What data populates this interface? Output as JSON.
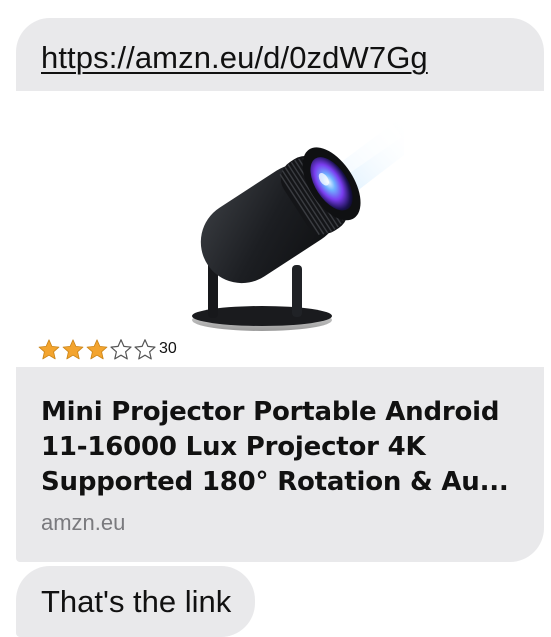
{
  "link_message": {
    "url": "https://amzn.eu/d/0zdW7Gg"
  },
  "link_preview": {
    "image_icon": "projector-product-image",
    "rating": {
      "filled_stars": 3,
      "total_stars": 5,
      "star_color": "#f3a42e",
      "review_count": "30"
    },
    "title": "Mini Projector Portable Android 11-16000 Lux Projector 4K Supported 180° Rotation & Au...",
    "domain": "amzn.eu"
  },
  "reply_message": {
    "text": "That's the link"
  },
  "colors": {
    "bubble_background": "#e9e9eb",
    "text": "#111111",
    "domain_text": "#7a7a7e"
  }
}
